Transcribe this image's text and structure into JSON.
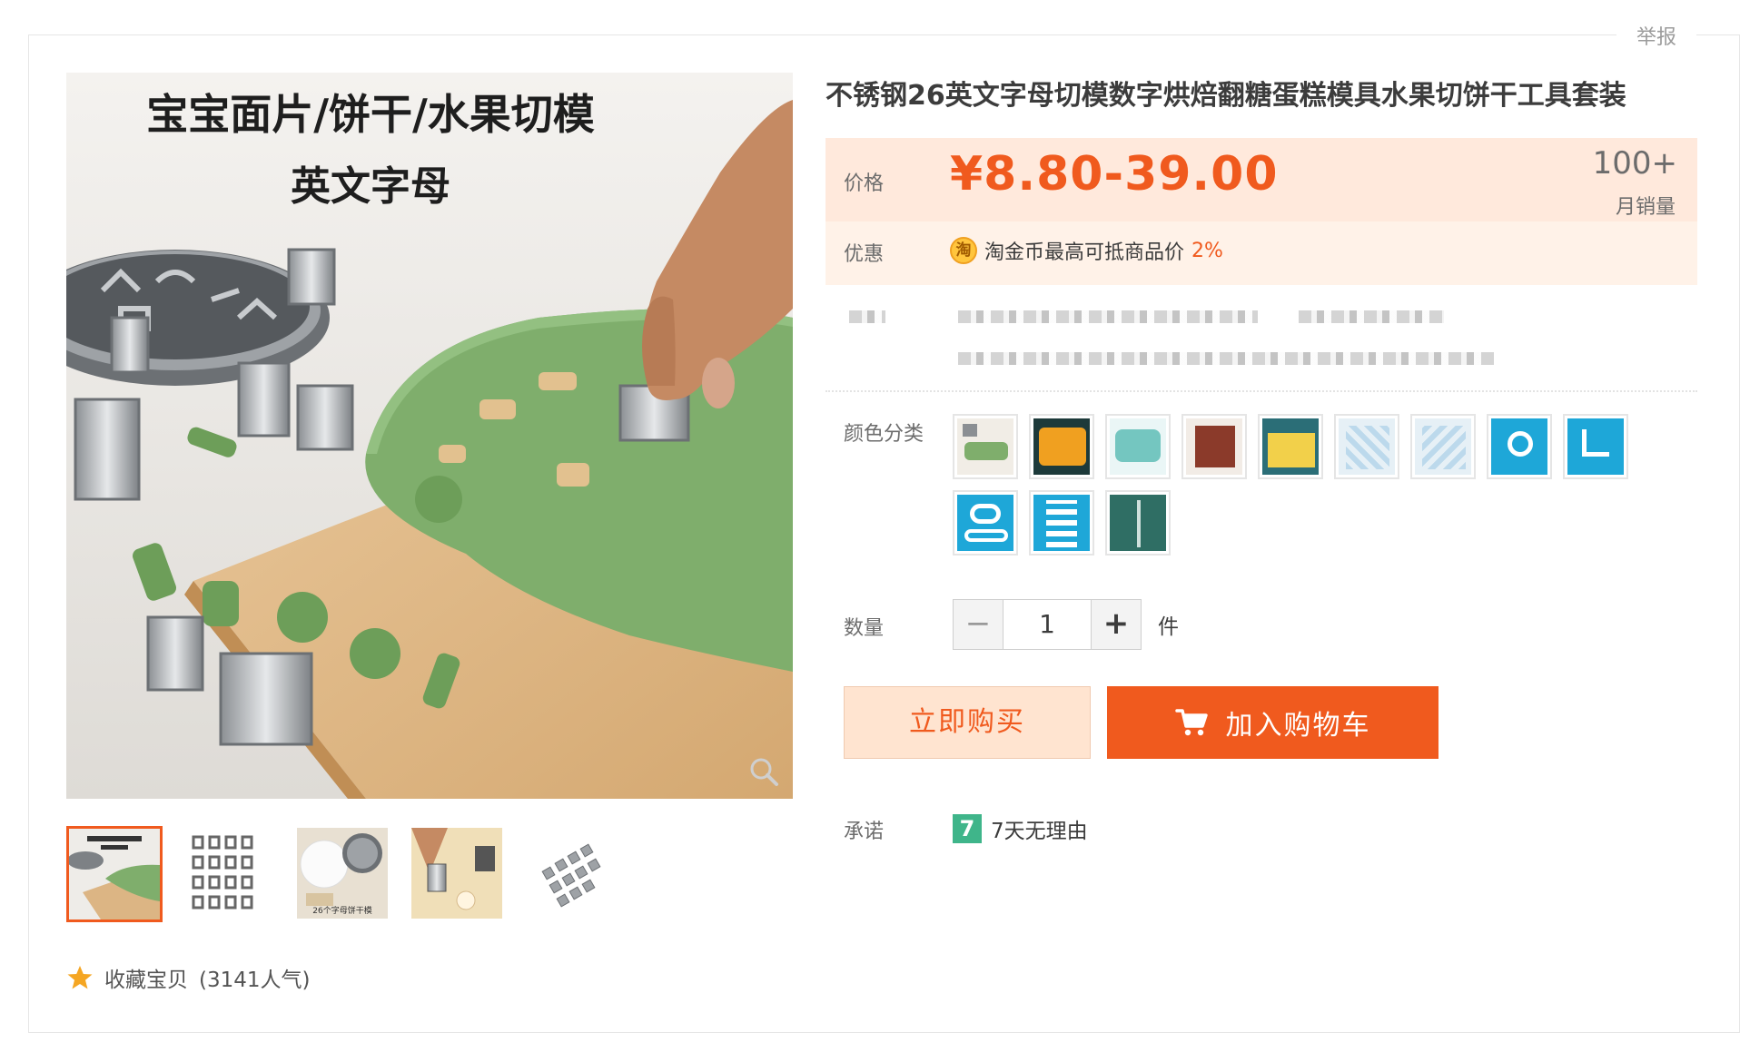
{
  "header": {
    "report_label": "举报"
  },
  "product": {
    "title": "不锈钢26英文字母切模数字烘焙翻糖蛋糕模具水果切饼干工具套装",
    "image_heading_line1": "宝宝面片/饼干/水果切模",
    "image_heading_line2": "英文字母",
    "thumbnail_caption": "26个字母饼干模"
  },
  "price": {
    "label": "价格",
    "value": "¥8.80-39.00",
    "sales_count": "100+",
    "sales_label": "月销量"
  },
  "promotion": {
    "label": "优惠",
    "coin_icon_text": "淘",
    "text": "淘金币最高可抵商品价",
    "percent": "2%"
  },
  "sku": {
    "label": "颜色分类",
    "options": [
      {
        "icon": "cutter-set-thumb"
      },
      {
        "icon": "orange-tray-thumb"
      },
      {
        "icon": "teal-mould-thumb"
      },
      {
        "icon": "red-box-thumb"
      },
      {
        "icon": "letter-chart-thumb"
      },
      {
        "icon": "clear-mould-thumb"
      },
      {
        "icon": "clear-mould-2-thumb"
      },
      {
        "icon": "cyan-logo-c-thumb"
      },
      {
        "icon": "cyan-logo-lv-thumb"
      },
      {
        "icon": "cyan-logo-g-thumb"
      },
      {
        "icon": "cyan-grid-thumb"
      },
      {
        "icon": "green-box-thumb"
      }
    ]
  },
  "quantity": {
    "label": "数量",
    "value": "1",
    "minus": "−",
    "plus": "+",
    "unit": "件"
  },
  "actions": {
    "buy_now": "立即购买",
    "add_to_cart": "加入购物车"
  },
  "promise": {
    "label": "承诺",
    "badge": "7",
    "text": "7天无理由"
  },
  "favorite": {
    "text": "收藏宝贝",
    "popularity": "(3141人气)"
  },
  "colors": {
    "accent": "#f05a1e",
    "price_bg": "#fff2e8",
    "buy_now_bg": "#ffe4d0"
  }
}
